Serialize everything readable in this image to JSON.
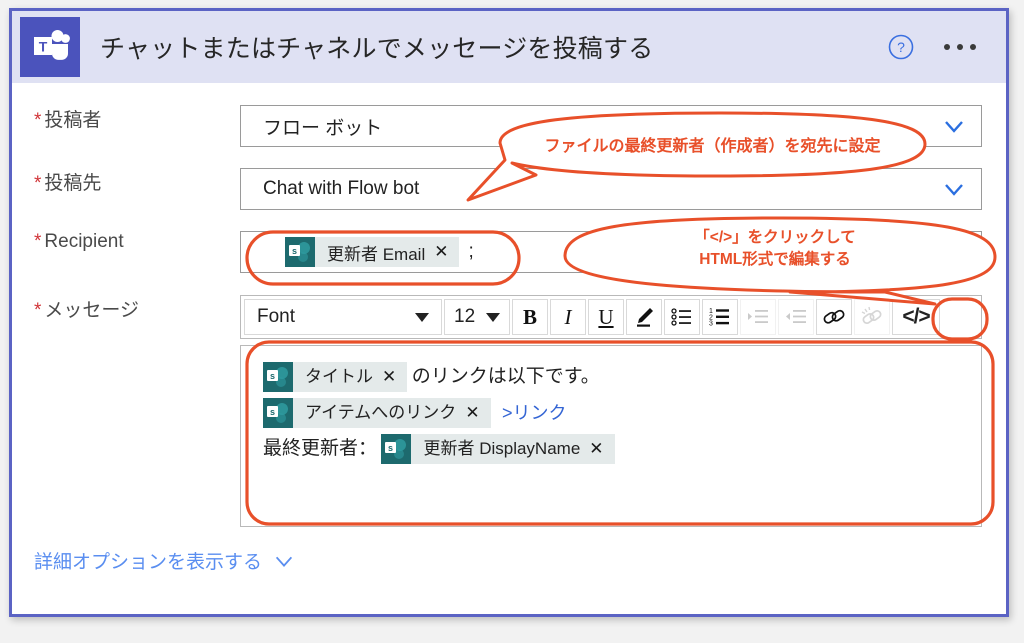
{
  "header": {
    "title": "チャットまたはチャネルでメッセージを投稿する",
    "logo_icon": "teams-logo-icon",
    "help_icon": "help-circle-icon",
    "more_icon": "more-options-icon"
  },
  "fields": {
    "poster": {
      "label": "投稿者",
      "required_mark": "*",
      "value": "フロー ボット",
      "chevron_icon": "chevron-down-icon"
    },
    "post_to": {
      "label": "投稿先",
      "required_mark": "*",
      "value": "Chat with Flow bot",
      "chevron_icon": "chevron-down-icon"
    },
    "recipient": {
      "label": "Recipient",
      "required_mark": "*",
      "token": "更新者 Email",
      "token_icon": "sharepoint-icon",
      "token_remove": "✕",
      "separator": ";"
    },
    "message": {
      "label": "メッセージ",
      "required_mark": "*"
    }
  },
  "toolbar": {
    "font_label": "Font",
    "font_size": "12",
    "bold": "B",
    "italic": "I",
    "underline": "U",
    "pen_icon": "pen-highlighter-icon",
    "bullet_list_icon": "bullet-list-icon",
    "numbered_list_icon": "numbered-list-icon",
    "indent_icon": "indent-increase-icon",
    "outdent_icon": "indent-decrease-icon",
    "link_icon": "link-icon",
    "unlink_icon": "unlink-icon",
    "code_label": "</>",
    "code_icon": "code-view-icon",
    "caret_icon": "caret-down-icon"
  },
  "message_body": {
    "line1": {
      "token": "タイトル",
      "token_icon": "sharepoint-icon",
      "token_remove": "✕",
      "text": "のリンクは以下です。"
    },
    "line2": {
      "token": "アイテムへのリンク",
      "token_icon": "sharepoint-icon",
      "token_remove": "✕",
      "link_text": ">リンク"
    },
    "line3": {
      "prefix": "最終更新者：",
      "token": "更新者 DisplayName",
      "token_icon": "sharepoint-icon",
      "token_remove": "✕"
    }
  },
  "footer": {
    "advanced_options": "詳細オプションを表示する",
    "chevron_icon": "chevron-down-icon"
  },
  "annotations": {
    "callout1": {
      "text": "ファイルの最終更新者（作成者）を宛先に設定"
    },
    "callout2": {
      "line1": "「</>」をクリックして",
      "line2": "HTML形式で編集する"
    },
    "highlight_recipient": "recipient-field-highlight",
    "highlight_message": "message-body-highlight"
  },
  "colors": {
    "annotation": "#e8502a",
    "teams_purple": "#4b53bc",
    "header_bg": "#dfe1f3",
    "link_blue": "#5a8ef0",
    "required_red": "#d13438",
    "sharepoint_teal": "#1d6a6e"
  }
}
